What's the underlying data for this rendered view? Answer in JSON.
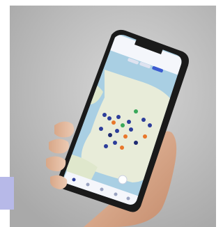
{
  "scene": {
    "subject": "hand-holding-smartphone",
    "background_color": "#c9c9c9",
    "corner_tab_color": "#b7b9e8"
  },
  "phone": {
    "body_color": "#1a1a1a",
    "screen_app": "map-app",
    "map_water_color": "#a9cfe3",
    "map_land_color": "#e8ecd9",
    "pin_colors": [
      "#2c3d9a",
      "#e8772b",
      "#39a85a",
      "#1e2a70"
    ]
  },
  "app_ui": {
    "header_title": "",
    "chips": [
      "",
      "",
      ""
    ],
    "nav_items": [
      {
        "icon": "home-icon"
      },
      {
        "icon": "map-icon"
      },
      {
        "icon": "list-icon"
      },
      {
        "icon": "profile-icon"
      },
      {
        "icon": "settings-icon"
      }
    ]
  }
}
